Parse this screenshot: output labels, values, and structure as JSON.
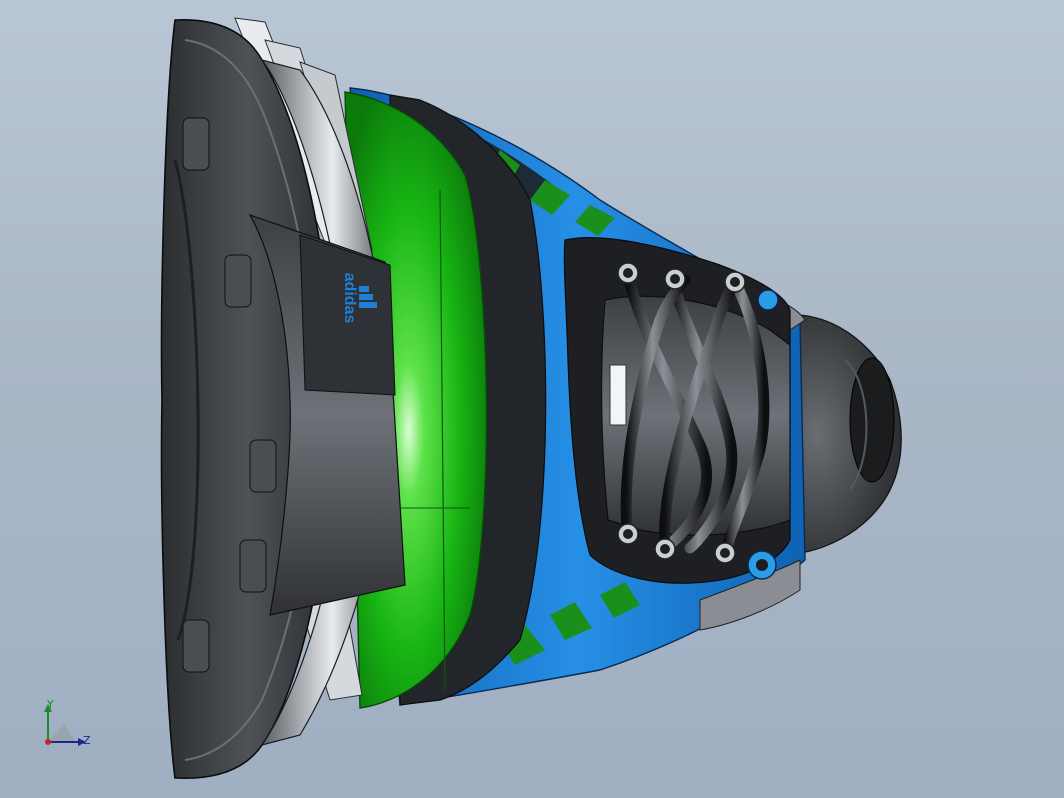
{
  "view": {
    "background_top": "#b9c6d6",
    "background_bottom": "#9fafc2"
  },
  "model": {
    "brand_text": "adidas",
    "colors": {
      "sole_dark": "#3b3e42",
      "sole_mid": "#6b6f75",
      "sole_light": "#d9dde1",
      "green": "#22c21f",
      "blue": "#1f7fd6",
      "black": "#141517"
    }
  },
  "triad": {
    "y_label": "Y",
    "z_label": "Z",
    "y_color": "#1b8a2a",
    "z_color": "#1a2a8a",
    "x_color": "#c0282d"
  }
}
